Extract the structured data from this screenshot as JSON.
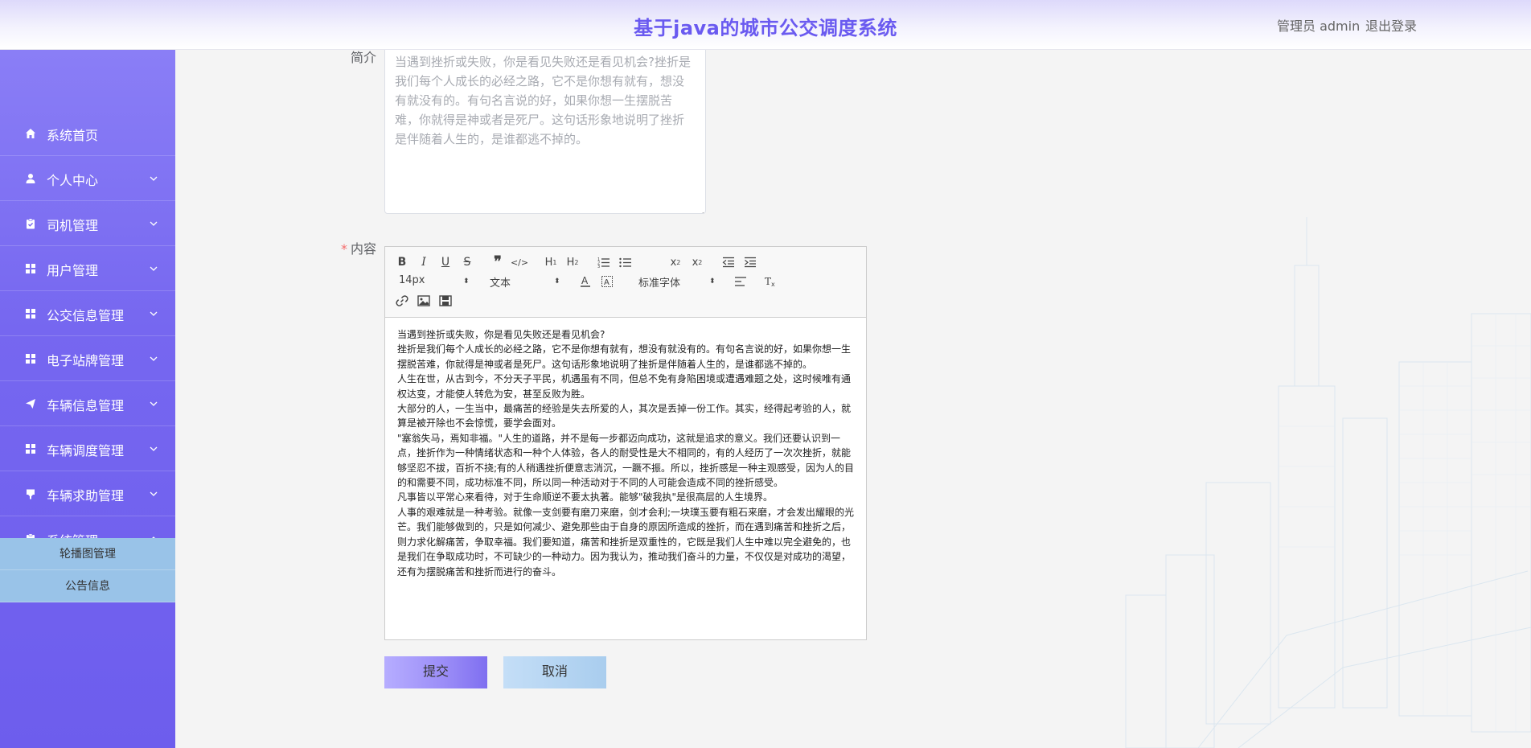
{
  "header": {
    "title": "基于java的城市公交调度系统",
    "user": "管理员 admin",
    "logout": "退出登录"
  },
  "sidebar": {
    "items": [
      {
        "label": "系统首页",
        "icon": "home-icon"
      },
      {
        "label": "个人中心",
        "icon": "user-icon"
      },
      {
        "label": "司机管理",
        "icon": "clipboard-icon"
      },
      {
        "label": "用户管理",
        "icon": "grid-icon"
      },
      {
        "label": "公交信息管理",
        "icon": "grid-icon"
      },
      {
        "label": "电子站牌管理",
        "icon": "grid-icon"
      },
      {
        "label": "车辆信息管理",
        "icon": "send-icon"
      },
      {
        "label": "车辆调度管理",
        "icon": "grid-icon"
      },
      {
        "label": "车辆求助管理",
        "icon": "flag-icon"
      },
      {
        "label": "系统管理",
        "icon": "clipboard-icon"
      }
    ],
    "submenu": [
      "轮播图管理",
      "公告信息"
    ]
  },
  "form": {
    "intro_label": "简介",
    "intro_value": "当遇到挫折或失败，你是看见失败还是看见机会?挫折是我们每个人成长的必经之路，它不是你想有就有，想没有就没有的。有句名言说的好，如果你想一生摆脱苦难，你就得是神或者是死尸。这句话形象地说明了挫折是伴随着人生的，是谁都逃不掉的。",
    "content_label": "内容",
    "required_mark": "*",
    "toolbar": {
      "size": "14px",
      "header": "文本",
      "font": "标准字体"
    },
    "paragraphs": [
      "当遇到挫折或失败，你是看见失败还是看见机会?",
      "挫折是我们每个人成长的必经之路，它不是你想有就有，想没有就没有的。有句名言说的好，如果你想一生摆脱苦难，你就得是神或者是死尸。这句话形象地说明了挫折是伴随着人生的，是谁都逃不掉的。",
      "人生在世，从古到今，不分天子平民，机遇虽有不同，但总不免有身陷困境或遭遇难题之处，这时候唯有通权达变，才能使人转危为安，甚至反败为胜。",
      "大部分的人，一生当中，最痛苦的经验是失去所爱的人，其次是丢掉一份工作。其实，经得起考验的人，就算是被开除也不会惊慌，要学会面对。",
      "\"塞翁失马，焉知非福。\"人生的道路，并不是每一步都迈向成功，这就是追求的意义。我们还要认识到一点，挫折作为一种情绪状态和一种个人体验，各人的耐受性是大不相同的，有的人经历了一次次挫折，就能够坚忍不拔，百折不挠;有的人稍遇挫折便意志消沉，一蹶不振。所以，挫折感是一种主观感受，因为人的目的和需要不同，成功标准不同，所以同一种活动对于不同的人可能会造成不同的挫折感受。",
      "凡事皆以平常心来看待，对于生命顺逆不要太执著。能够\"破我执\"是很高层的人生境界。",
      "人事的艰难就是一种考验。就像一支剑要有磨刀来磨，剑才会利;一块璞玉要有粗石来磨，才会发出耀眼的光芒。我们能够做到的，只是如何减少、避免那些由于自身的原因所造成的挫折，而在遇到痛苦和挫折之后，则力求化解痛苦，争取幸福。我们要知道，痛苦和挫折是双重性的，它既是我们人生中难以完全避免的，也是我们在争取成功时，不可缺少的一种动力。因为我认为，推动我们奋斗的力量，不仅仅是对成功的渴望，还有为摆脱痛苦和挫折而进行的奋斗。"
    ],
    "submit": "提交",
    "cancel": "取消"
  },
  "colors": {
    "accent": "#6a5af0",
    "sidebar": "#7667f0",
    "submenu": "#99c3e8"
  }
}
